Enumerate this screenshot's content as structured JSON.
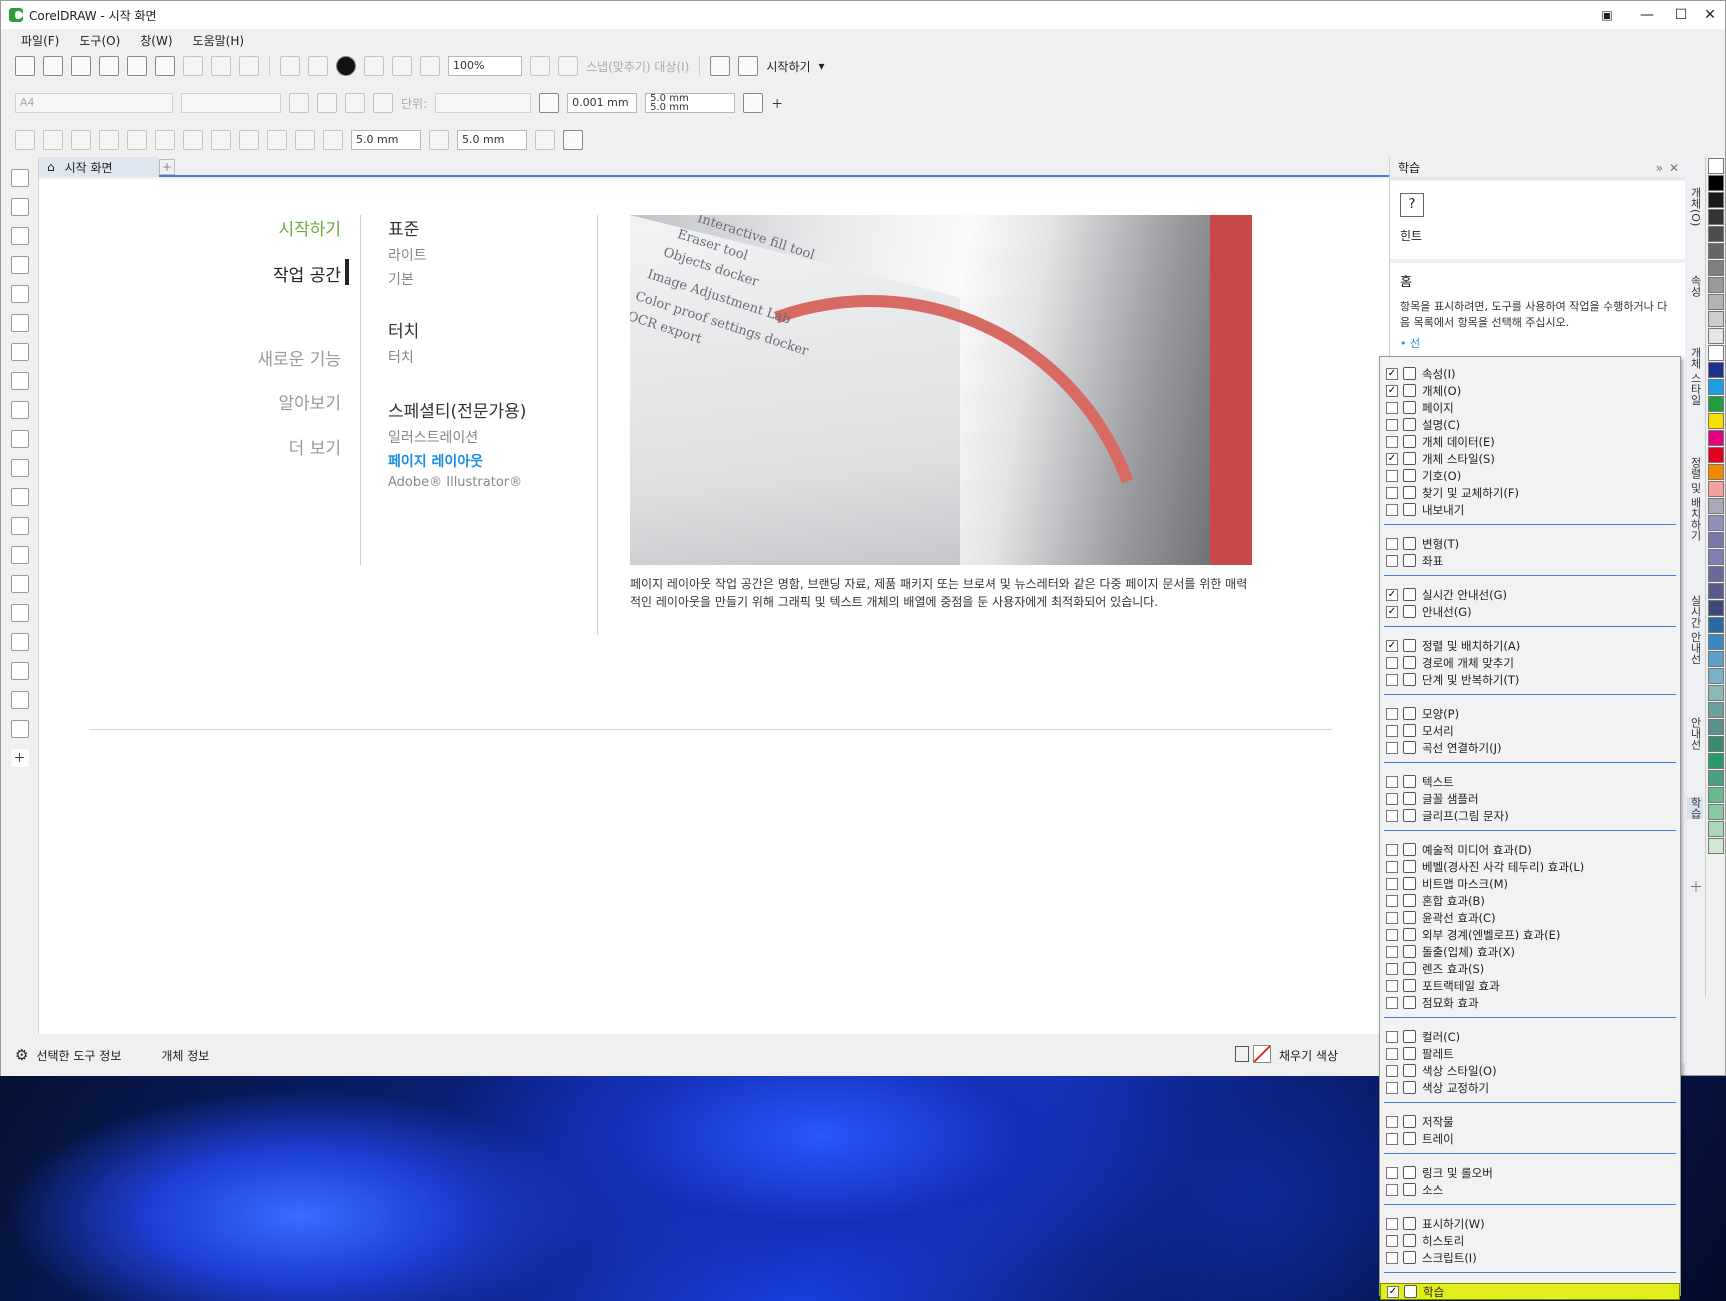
{
  "window": {
    "title": "CorelDRAW - 시작 화면"
  },
  "menubar": [
    "파일(F)",
    "도구(O)",
    "창(W)",
    "도움말(H)"
  ],
  "toolbar": {
    "zoom": "100%",
    "snap_label": "스냅(맞추기) 대상(I)",
    "start_label": "시작하기"
  },
  "propbar": {
    "page_size": "A4",
    "units_label": "단위:",
    "nudge": "0.001 mm",
    "dup_x": "5.0 mm",
    "dup_y": "5.0 mm"
  },
  "propbar2": {
    "w1": "5.0 mm",
    "w2": "5.0 mm"
  },
  "tabs": {
    "home": "시작 화면"
  },
  "welcome": {
    "nav": [
      "시작하기",
      "작업 공간",
      "새로운 기능",
      "알아보기",
      "더 보기"
    ],
    "workspaces": [
      {
        "head": "표준",
        "items": [
          "라이트",
          "기본"
        ]
      },
      {
        "head": "터치",
        "items": [
          "터치"
        ]
      },
      {
        "head": "스페셜티(전문가용)",
        "items": [
          "일러스트레이션",
          "페이지 레이아웃",
          "Adobe® Illustrator®"
        ]
      }
    ],
    "hero_lines": [
      "Interactive fill tool",
      "Eraser tool",
      "Objects docker",
      "Image Adjustment Lab",
      "Color proof settings docker",
      "OCR export"
    ],
    "description": "페이지 레이아웃 작업 공간은 명함, 브랜딩 자료, 제품 패키지 또는 브로셔 및 뉴스레터와 같은 다중 페이지 문서를 위한 매력적인 레이아웃을 만들기 위해 그래픽 및 텍스트 개체의 배열에 중점을 둔 사용자에게 최적화되어 있습니다."
  },
  "status": {
    "tool_info": "선택한 도구 정보",
    "object_info": "개체 정보",
    "fill_color": "채우기 색상"
  },
  "learn": {
    "title": "학습",
    "hint": "힌트",
    "home": "홈",
    "desc": "항목을 표시하려면, 도구를 사용하여 작업을 수행하거나 다음 목록에서 항목을 선택해 주십시오.",
    "partial": "• 선"
  },
  "right_tabs": [
    "개체(O)",
    "속성",
    "개체 스타일",
    "정렬 및 배치하기",
    "실시간 안내선",
    "안내선",
    "학습"
  ],
  "palette": [
    "#ffffff",
    "#000000",
    "#1a1a1a",
    "#333333",
    "#4d4d4d",
    "#666666",
    "#808080",
    "#999999",
    "#b3b3b3",
    "#cccccc",
    "#e6e6e6",
    "#ffffff",
    "#1f2f8f",
    "#1aa0e0",
    "#1e9e3e",
    "#f5e000",
    "#e6007e",
    "#e2001a",
    "#f08a00",
    "#f5a0a0",
    "#a8a8b8",
    "#9090b8",
    "#7878a8",
    "#8080b0",
    "#6a6a9a",
    "#5a5a8a",
    "#3a4a7a",
    "#2a6aa0",
    "#3a8ac0",
    "#5aa0c8",
    "#7ab0c8",
    "#8ab8b8",
    "#6aa0a0",
    "#5a9090",
    "#3a8a70",
    "#2a9a6a",
    "#4aa080",
    "#6ab890",
    "#8ac8a0",
    "#aad8b8",
    "#d0e8d0"
  ],
  "menu": [
    {
      "group": [
        {
          "label": "속성(I)",
          "checked": true
        },
        {
          "label": "개체(O)",
          "checked": true
        },
        {
          "label": "페이지",
          "checked": false
        },
        {
          "label": "설명(C)",
          "checked": false
        },
        {
          "label": "개체 데이터(E)",
          "checked": false
        },
        {
          "label": "개체 스타일(S)",
          "checked": true
        },
        {
          "label": "기호(O)",
          "checked": false
        },
        {
          "label": "찾기 및 교체하기(F)",
          "checked": false
        },
        {
          "label": "내보내기",
          "checked": false
        }
      ]
    },
    {
      "group": [
        {
          "label": "변형(T)",
          "checked": false
        },
        {
          "label": "좌표",
          "checked": false
        }
      ]
    },
    {
      "group": [
        {
          "label": "실시간 안내선(G)",
          "checked": true
        },
        {
          "label": "안내선(G)",
          "checked": true
        }
      ]
    },
    {
      "group": [
        {
          "label": "정렬 및 배치하기(A)",
          "checked": true
        },
        {
          "label": "경로에 개체 맞추기",
          "checked": false
        },
        {
          "label": "단계 및 반복하기(T)",
          "checked": false
        }
      ]
    },
    {
      "group": [
        {
          "label": "모양(P)",
          "checked": false
        },
        {
          "label": "모서리",
          "checked": false
        },
        {
          "label": "곡선 연결하기(J)",
          "checked": false
        }
      ]
    },
    {
      "group": [
        {
          "label": "텍스트",
          "checked": false
        },
        {
          "label": "글꼴 샘플러",
          "checked": false
        },
        {
          "label": "글리프(그림 문자)",
          "checked": false
        }
      ]
    },
    {
      "group": [
        {
          "label": "예술적 미디어 효과(D)",
          "checked": false
        },
        {
          "label": "베벨(경사진 사각 테두리) 효과(L)",
          "checked": false
        },
        {
          "label": "비트맵 마스크(M)",
          "checked": false
        },
        {
          "label": "혼합 효과(B)",
          "checked": false
        },
        {
          "label": "윤곽선 효과(C)",
          "checked": false
        },
        {
          "label": "외부 경계(엔벨로프) 효과(E)",
          "checked": false
        },
        {
          "label": "돌출(입체) 효과(X)",
          "checked": false
        },
        {
          "label": "렌즈 효과(S)",
          "checked": false
        },
        {
          "label": "포트랙테일 효과",
          "checked": false
        },
        {
          "label": "점묘화 효과",
          "checked": false
        }
      ]
    },
    {
      "group": [
        {
          "label": "컬러(C)",
          "checked": false
        },
        {
          "label": "팔레트",
          "checked": false
        },
        {
          "label": "색상 스타일(O)",
          "checked": false
        },
        {
          "label": "색상 교정하기",
          "checked": false
        }
      ]
    },
    {
      "group": [
        {
          "label": "저작물",
          "checked": false
        },
        {
          "label": "트레이",
          "checked": false
        }
      ]
    },
    {
      "group": [
        {
          "label": "링크 및 롤오버",
          "checked": false
        },
        {
          "label": "소스",
          "checked": false
        }
      ]
    },
    {
      "group": [
        {
          "label": "표시하기(W)",
          "checked": false
        },
        {
          "label": "히스토리",
          "checked": false
        },
        {
          "label": "스크립트(I)",
          "checked": false
        }
      ]
    },
    {
      "group": [
        {
          "label": "학습",
          "checked": true,
          "highlight": true
        }
      ]
    }
  ]
}
